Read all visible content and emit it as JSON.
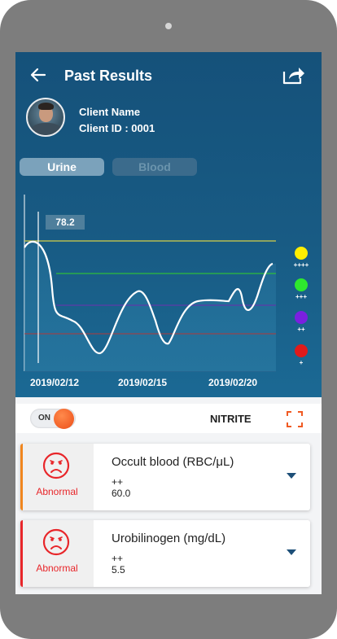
{
  "header": {
    "title": "Past Results",
    "back_icon": "back-arrow-icon",
    "share_icon": "share-icon"
  },
  "client": {
    "name_label": "Client Name",
    "id_label": "Client ID : 0001"
  },
  "tabs": [
    {
      "label": "Urine",
      "selected": true
    },
    {
      "label": "Blood",
      "selected": false
    }
  ],
  "chart_data": {
    "type": "line",
    "x_tick_labels": [
      "2019/02/12",
      "2019/02/15",
      "2019/02/20"
    ],
    "cursor_value": "78.2",
    "legend": [
      {
        "label": "++++",
        "color": "#ffee00"
      },
      {
        "label": "+++",
        "color": "#2ee82e"
      },
      {
        "label": "++",
        "color": "#7a1fe0"
      },
      {
        "label": "+",
        "color": "#e01a1a"
      }
    ],
    "threshold_colors": [
      "#d4cf49",
      "#2fbf3a",
      "#5f3aa8",
      "#b03a3a"
    ],
    "grid": false
  },
  "toggle": {
    "label": "ON",
    "state": true,
    "accent": "#f05a22"
  },
  "parameter": {
    "name": "NITRITE",
    "expand_icon": "fullscreen-icon"
  },
  "results": [
    {
      "status": "Abnormal",
      "icon": "sad-face-icon",
      "name": "Occult blood (RBC/μL)",
      "level": "++",
      "value": "60.0",
      "bar_color": "#f0861e"
    },
    {
      "status": "Abnormal",
      "icon": "sad-face-icon",
      "name": "Urobilinogen (mg/dL)",
      "level": "++",
      "value": "5.5",
      "bar_color": "#e8262a"
    }
  ],
  "colors": {
    "header_bg": "#15517a",
    "abnormal": "#e8262a"
  }
}
